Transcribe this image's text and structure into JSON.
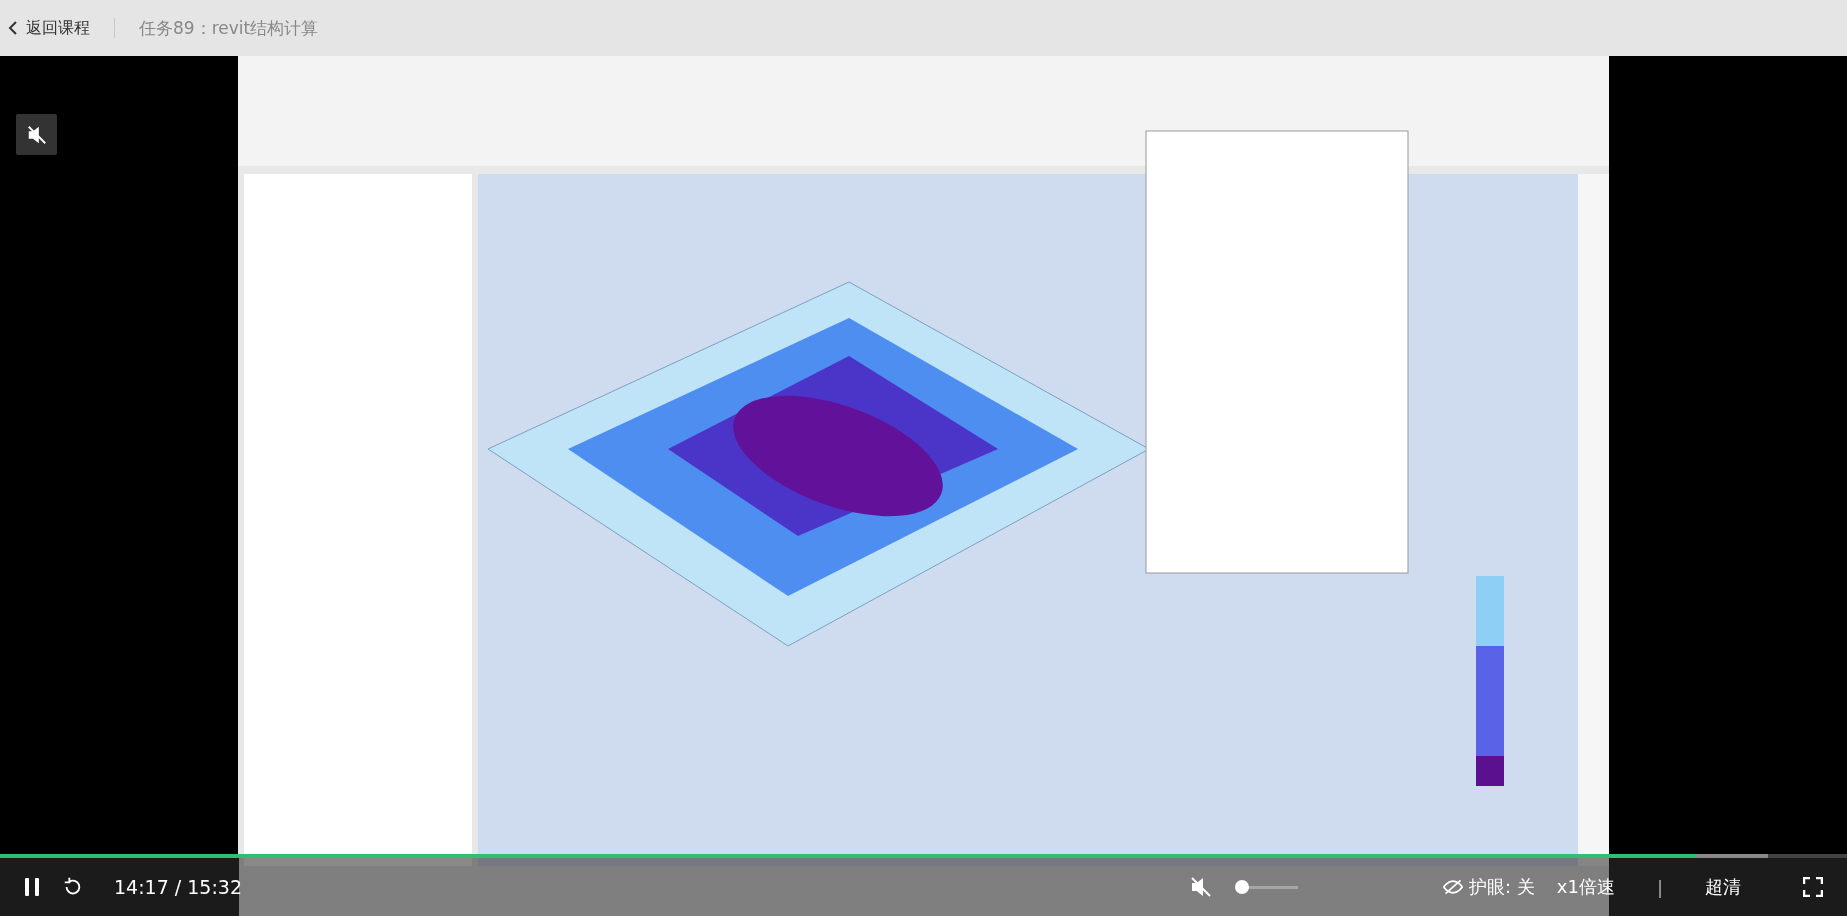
{
  "header": {
    "back": "返回课程",
    "title": "任务89：revit结构计算"
  },
  "video": {
    "kind": "picture",
    "muted": true
  },
  "player": {
    "progress": {
      "level": 0.918
    },
    "buffer": {
      "level": 0.957
    },
    "playing": true,
    "time": "14:17 / 15:32",
    "volume": {
      "muted": true,
      "level": 0
    },
    "eye_care": "护眼: 关",
    "speed": "x1倍速",
    "separator": "|",
    "quality": "超清"
  }
}
